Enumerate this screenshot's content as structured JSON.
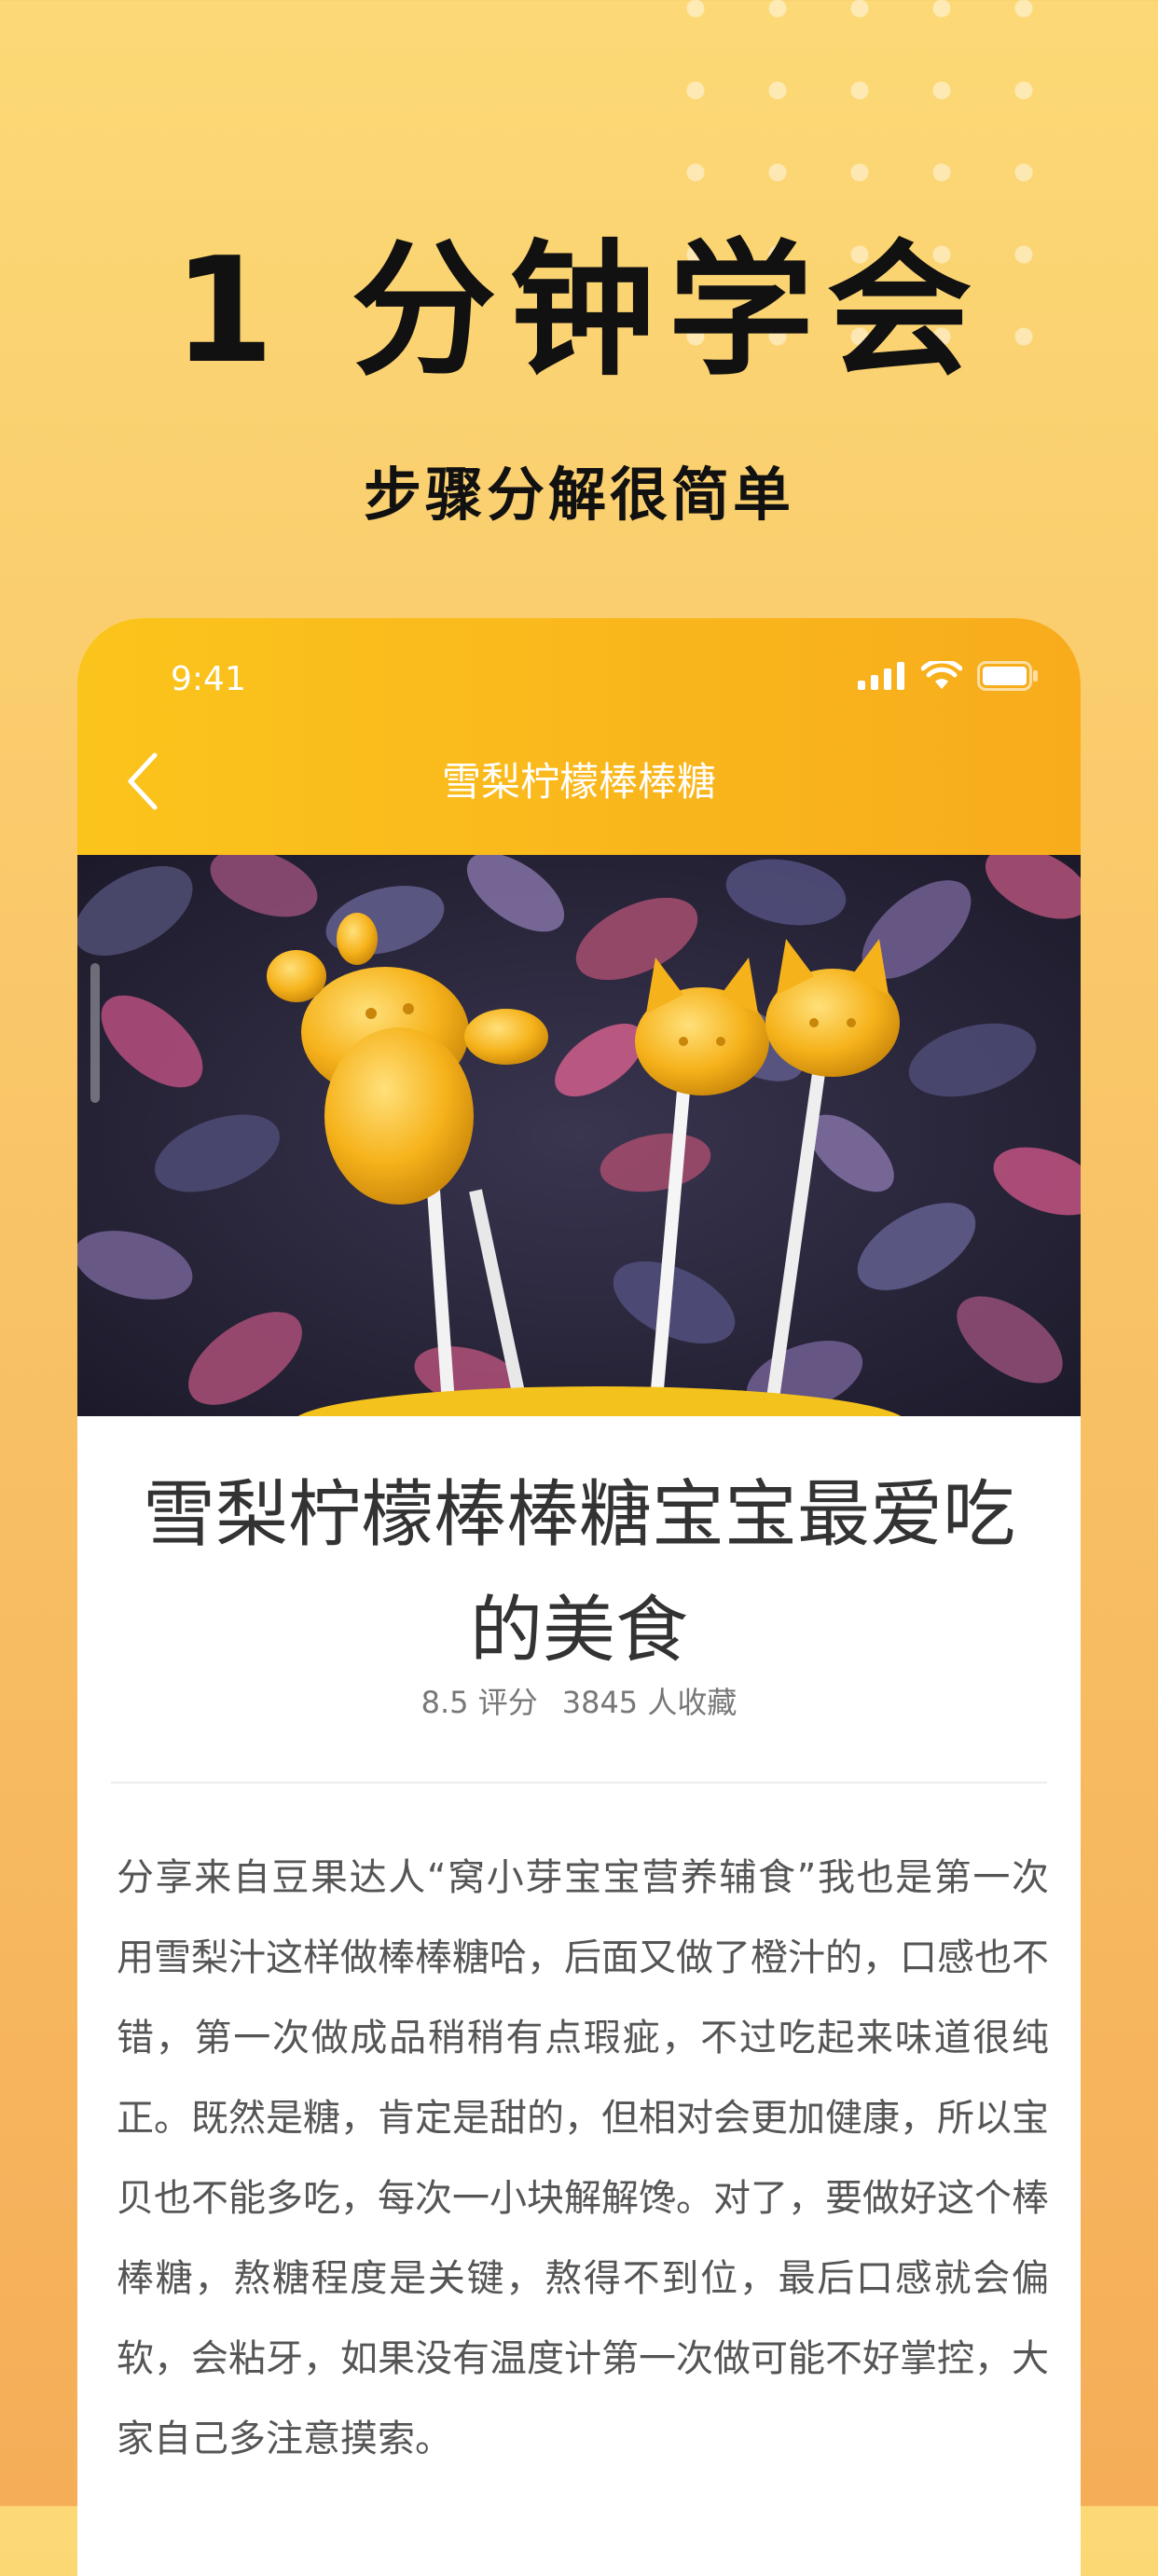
{
  "promo": {
    "headline": "1 分钟学会",
    "subline": "步骤分解很简单"
  },
  "status_bar": {
    "time": "9:41",
    "icons": [
      "signal-icon",
      "wifi-icon",
      "battery-icon"
    ]
  },
  "nav": {
    "back_icon": "chevron-left-icon",
    "title": "雪梨柠檬棒棒糖"
  },
  "recipe": {
    "hero_image": "lollipop-photo",
    "title": "雪梨柠檬棒棒糖宝宝最爱吃的美食",
    "rating": "8.5 评分",
    "favorites": "3845 人收藏",
    "description": "分享来自豆果达人“窝小芽宝宝营养辅食”我也是第一次用雪梨汁这样做棒棒糖哈，后面又做了橙汁的，口感也不错，第一次做成品稍稍有点瑕疵，不过吃起来味道很纯正。既然是糖，肯定是甜的，但相对会更加健康，所以宝贝也不能多吃，每次一小块解解馋。对了，要做好这个棒棒糖，熬糖程度是关键，熬得不到位，最后口感就会偏软，会粘牙，如果没有温度计第一次做可能不好掌控，大家自己多注意摸索。"
  },
  "colors": {
    "background_top": "#fcd976",
    "background_bottom": "#f5ad58",
    "header_accent": "#f8ac1c",
    "title_text": "#333333",
    "body_text": "#555555"
  }
}
